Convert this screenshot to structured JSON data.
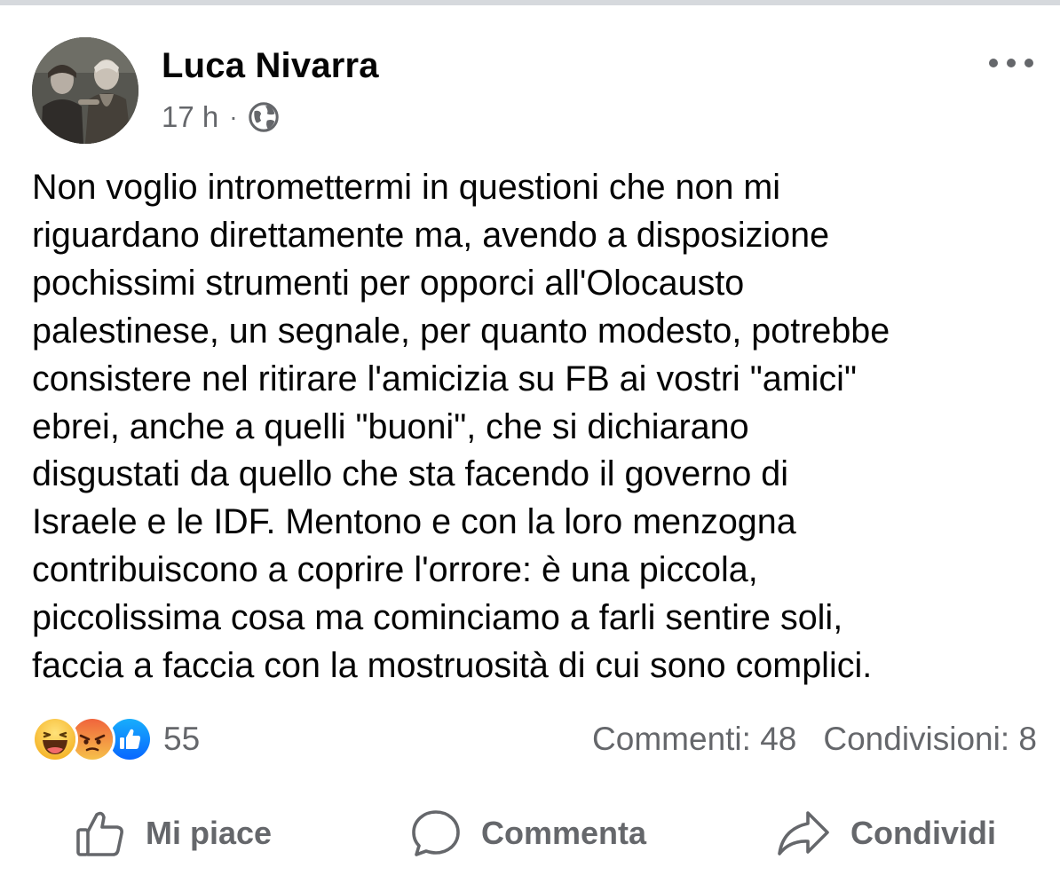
{
  "post": {
    "author_name": "Luca Nivarra",
    "timestamp": "17 h",
    "separator": "·",
    "privacy_icon": "globe-icon",
    "text": "Non voglio intromettermi in questioni che non mi\nriguardano direttamente ma, avendo a disposizione\npochissimi strumenti per opporci all'Olocausto\npalestinese, un segnale, per quanto modesto, potrebbe\nconsistere nel ritirare l'amicizia su FB ai vostri \"amici\"\nebrei, anche a quelli \"buoni\", che si dichiarano\ndisgustati da quello che sta facendo il governo di\nIsraele e le IDF. Mentono e con la loro menzogna\ncontribuiscono a coprire l'orrore: è una piccola,\npiccolissima cosa ma cominciamo a farli sentire soli,\nfaccia a faccia con la mostruosità di cui sono complici."
  },
  "reactions": {
    "icons": [
      "haha-reaction-icon",
      "angry-reaction-icon",
      "like-reaction-icon"
    ],
    "count": "55"
  },
  "stats": {
    "comments": "Commenti: 48",
    "shares": "Condivisioni: 8"
  },
  "actions": {
    "like_label": "Mi piace",
    "comment_label": "Commenta",
    "share_label": "Condividi"
  },
  "colors": {
    "text_primary": "#050505",
    "text_secondary": "#65676b",
    "like_blue": "#1877f2",
    "haha_yellow": "#f7c948",
    "angry_orange": "#f0643c"
  }
}
